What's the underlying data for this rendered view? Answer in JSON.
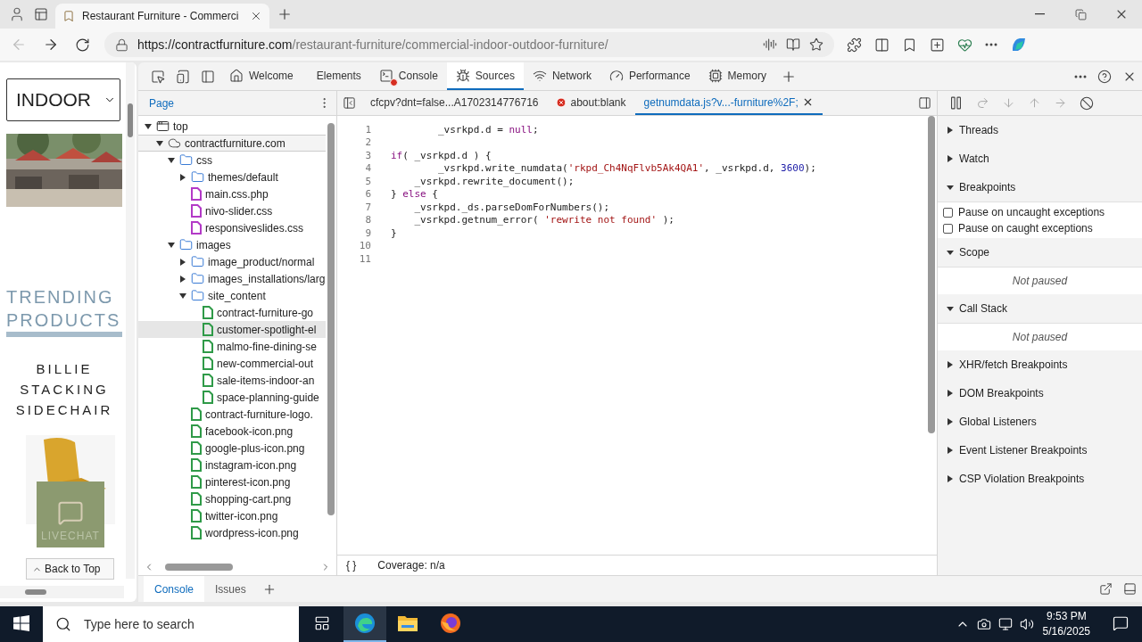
{
  "browser": {
    "tab": {
      "title": "Restaurant Furniture - Commerci"
    },
    "address": {
      "host": "https://contractfurniture.com",
      "path": "/restaurant-furniture/commercial-indoor-outdoor-furniture/"
    }
  },
  "page": {
    "select": {
      "value": "INDOOR"
    },
    "heading": [
      "TRENDING",
      "PRODUCTS"
    ],
    "product": [
      "BILLIE",
      "STACKING",
      "SIDECHAIR"
    ],
    "livechat": "LIVECHAT",
    "back_to_top": "Back to Top"
  },
  "devtools": {
    "tabs": [
      {
        "label": "Welcome",
        "kind": "welcome",
        "selected": false,
        "error": false
      },
      {
        "label": "Elements",
        "kind": "elements",
        "selected": false,
        "error": false
      },
      {
        "label": "Console",
        "kind": "console",
        "selected": false,
        "error": true
      },
      {
        "label": "Sources",
        "kind": "sources",
        "selected": true,
        "error": false
      },
      {
        "label": "Network",
        "kind": "network",
        "selected": false,
        "error": false
      },
      {
        "label": "Performance",
        "kind": "performance",
        "selected": false,
        "error": false
      },
      {
        "label": "Memory",
        "kind": "memory",
        "selected": false,
        "error": false
      }
    ],
    "navigator": {
      "tab": "Page",
      "tree": [
        {
          "label": "top",
          "kind": "frame",
          "expanded": true,
          "selected": false,
          "hovered": false,
          "children": [
            {
              "label": "contractfurniture.com",
              "kind": "domain",
              "expanded": true,
              "selected": true,
              "hovered": false,
              "children": [
                {
                  "label": "css",
                  "kind": "folder",
                  "expanded": true,
                  "selected": false,
                  "hovered": false,
                  "children": [
                    {
                      "label": "themes/default",
                      "kind": "folder",
                      "expanded": false,
                      "selected": false,
                      "hovered": false
                    },
                    {
                      "label": "main.css.php",
                      "kind": "file",
                      "color": "#b33ac7",
                      "selected": false,
                      "hovered": false
                    },
                    {
                      "label": "nivo-slider.css",
                      "kind": "file",
                      "color": "#b33ac7",
                      "selected": false,
                      "hovered": false
                    },
                    {
                      "label": "responsiveslides.css",
                      "kind": "file",
                      "color": "#b33ac7",
                      "selected": false,
                      "hovered": false
                    }
                  ]
                },
                {
                  "label": "images",
                  "kind": "folder",
                  "expanded": true,
                  "selected": false,
                  "hovered": false,
                  "children": [
                    {
                      "label": "image_product/normal",
                      "kind": "folder",
                      "expanded": false,
                      "selected": false,
                      "hovered": false
                    },
                    {
                      "label": "images_installations/larg",
                      "kind": "folder",
                      "expanded": false,
                      "selected": false,
                      "hovered": false
                    },
                    {
                      "label": "site_content",
                      "kind": "folder",
                      "expanded": true,
                      "selected": false,
                      "hovered": false,
                      "children": [
                        {
                          "label": "contract-furniture-go",
                          "kind": "file",
                          "color": "#2f9a48",
                          "selected": false,
                          "hovered": false
                        },
                        {
                          "label": "customer-spotlight-el",
                          "kind": "file",
                          "color": "#2f9a48",
                          "selected": false,
                          "hovered": true
                        },
                        {
                          "label": "malmo-fine-dining-se",
                          "kind": "file",
                          "color": "#2f9a48",
                          "selected": false,
                          "hovered": false
                        },
                        {
                          "label": "new-commercial-out",
                          "kind": "file",
                          "color": "#2f9a48",
                          "selected": false,
                          "hovered": false
                        },
                        {
                          "label": "sale-items-indoor-an",
                          "kind": "file",
                          "color": "#2f9a48",
                          "selected": false,
                          "hovered": false
                        },
                        {
                          "label": "space-planning-guide",
                          "kind": "file",
                          "color": "#2f9a48",
                          "selected": false,
                          "hovered": false
                        }
                      ]
                    },
                    {
                      "label": "contract-furniture-logo.",
                      "kind": "file",
                      "color": "#2f9a48",
                      "selected": false,
                      "hovered": false
                    },
                    {
                      "label": "facebook-icon.png",
                      "kind": "file",
                      "color": "#2f9a48",
                      "selected": false,
                      "hovered": false
                    },
                    {
                      "label": "google-plus-icon.png",
                      "kind": "file",
                      "color": "#2f9a48",
                      "selected": false,
                      "hovered": false
                    },
                    {
                      "label": "instagram-icon.png",
                      "kind": "file",
                      "color": "#2f9a48",
                      "selected": false,
                      "hovered": false
                    },
                    {
                      "label": "pinterest-icon.png",
                      "kind": "file",
                      "color": "#2f9a48",
                      "selected": false,
                      "hovered": false
                    },
                    {
                      "label": "shopping-cart.png",
                      "kind": "file",
                      "color": "#2f9a48",
                      "selected": false,
                      "hovered": false
                    },
                    {
                      "label": "twitter-icon.png",
                      "kind": "file",
                      "color": "#2f9a48",
                      "selected": false,
                      "hovered": false
                    },
                    {
                      "label": "wordpress-icon.png",
                      "kind": "file",
                      "color": "#2f9a48",
                      "selected": false,
                      "hovered": false
                    }
                  ]
                }
              ]
            }
          ]
        }
      ]
    },
    "editor": {
      "tabs": [
        {
          "label": "cfcpv?dnt=false...A1702314776716",
          "selected": false,
          "error": false,
          "closable": false
        },
        {
          "label": "about:blank",
          "selected": false,
          "error": true,
          "closable": false
        },
        {
          "label": "getnumdata.js?v...-furniture%2F;",
          "selected": true,
          "error": false,
          "closable": true
        }
      ],
      "lines": [
        {
          "number": "1",
          "tokens": [
            {
              "kind": "plain",
              "text": "        _vsrkpd.d = "
            },
            {
              "kind": "keyword",
              "text": "null"
            },
            {
              "kind": "plain",
              "text": ";"
            }
          ]
        },
        {
          "number": "2"
        },
        {
          "number": "3",
          "tokens": [
            {
              "kind": "keyword",
              "text": "if"
            },
            {
              "kind": "plain",
              "text": "( _vsrkpd.d ) {"
            }
          ]
        },
        {
          "number": "4",
          "tokens": [
            {
              "kind": "plain",
              "text": "        _vsrkpd.write_numdata("
            },
            {
              "kind": "string",
              "text": "'rkpd_Ch4NqFlvb5Ak4QA1'"
            },
            {
              "kind": "plain",
              "text": ", _vsrkpd.d, "
            },
            {
              "kind": "number",
              "text": "3600"
            },
            {
              "kind": "plain",
              "text": ");"
            }
          ]
        },
        {
          "number": "5",
          "tokens": [
            {
              "kind": "plain",
              "text": "    _vsrkpd.rewrite_document();"
            }
          ]
        },
        {
          "number": "6",
          "tokens": [
            {
              "kind": "plain",
              "text": "} "
            },
            {
              "kind": "keyword",
              "text": "else"
            },
            {
              "kind": "plain",
              "text": " {"
            }
          ]
        },
        {
          "number": "7",
          "tokens": [
            {
              "kind": "plain",
              "text": "    _vsrkpd._ds.parseDomForNumbers();"
            }
          ]
        },
        {
          "number": "8",
          "tokens": [
            {
              "kind": "plain",
              "text": "    _vsrkpd.getnum_error( "
            },
            {
              "kind": "string",
              "text": "'rewrite not found'"
            },
            {
              "kind": "plain",
              "text": " );"
            }
          ]
        },
        {
          "number": "9",
          "tokens": [
            {
              "kind": "plain",
              "text": "}"
            }
          ]
        },
        {
          "number": "10"
        },
        {
          "number": "11"
        }
      ],
      "status": {
        "format": "{ }",
        "coverage": "Coverage: n/a"
      }
    },
    "debugger": {
      "sections": [
        {
          "title": "Threads",
          "expanded": false
        },
        {
          "title": "Watch",
          "expanded": false
        },
        {
          "title": "Breakpoints",
          "expanded": true,
          "checkboxes": [
            {
              "label": "Pause on uncaught exceptions",
              "checked": false
            },
            {
              "label": "Pause on caught exceptions",
              "checked": false
            }
          ]
        },
        {
          "title": "Scope",
          "expanded": true,
          "message": "Not paused"
        },
        {
          "title": "Call Stack",
          "expanded": true,
          "message": "Not paused"
        },
        {
          "title": "XHR/fetch Breakpoints",
          "expanded": false
        },
        {
          "title": "DOM Breakpoints",
          "expanded": false
        },
        {
          "title": "Global Listeners",
          "expanded": false
        },
        {
          "title": "Event Listener Breakpoints",
          "expanded": false
        },
        {
          "title": "CSP Violation Breakpoints",
          "expanded": false
        }
      ]
    },
    "drawer": {
      "tabs": [
        {
          "label": "Console",
          "selected": true
        },
        {
          "label": "Issues",
          "selected": false
        }
      ]
    }
  },
  "taskbar": {
    "search": {
      "placeholder": "Type here to search"
    },
    "apps": [
      {
        "kind": "edge",
        "selected": true
      },
      {
        "kind": "explorer",
        "selected": false
      },
      {
        "kind": "firefox",
        "selected": false
      }
    ],
    "time": "9:53 PM",
    "date": "5/16/2025"
  }
}
